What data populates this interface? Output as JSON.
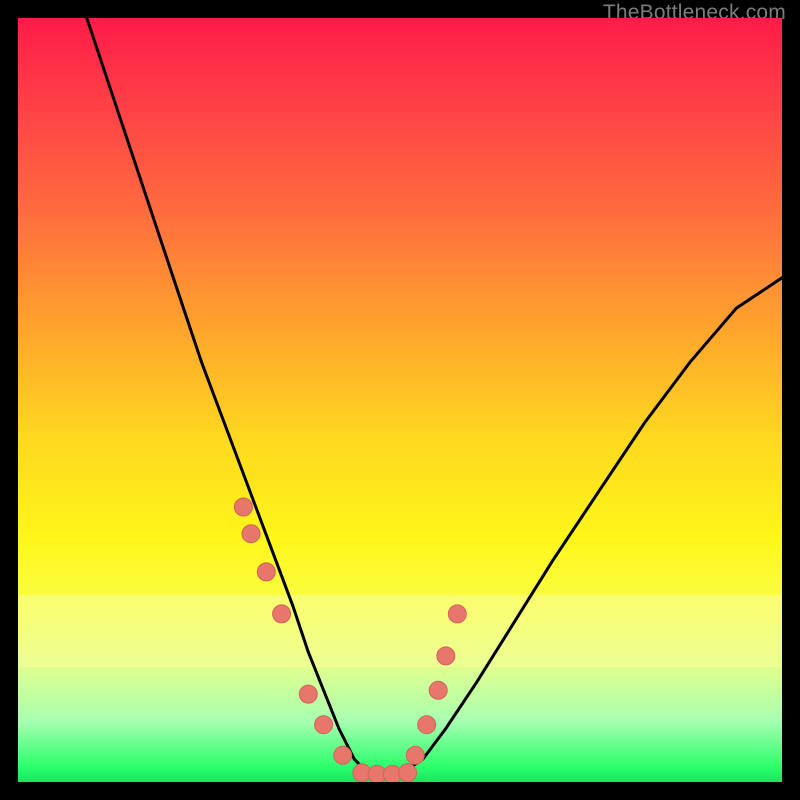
{
  "watermark": {
    "text": "TheBottleneck.com"
  },
  "colors": {
    "curve_stroke": "#000000",
    "dot_fill": "#e7766b",
    "dot_stroke": "#d1635a"
  },
  "chart_data": {
    "type": "line",
    "title": "",
    "xlabel": "",
    "ylabel": "",
    "xlim": [
      0,
      100
    ],
    "ylim": [
      0,
      100
    ],
    "grid": false,
    "notes": "Y is bottleneck % (0 at bottom, 100 at top). X is an unlabeled hardware balance axis. Curve is a V-shape; dots cluster near the minimum.",
    "series": [
      {
        "name": "bottleneck-curve",
        "kind": "line",
        "x": [
          9,
          12,
          15,
          18,
          21,
          24,
          27,
          30,
          33,
          36,
          38,
          40,
          42,
          44,
          46,
          48,
          50,
          53,
          56,
          60,
          65,
          70,
          76,
          82,
          88,
          94,
          100
        ],
        "y": [
          100,
          91,
          82,
          73,
          64,
          55,
          47,
          39,
          31,
          23,
          17,
          12,
          7,
          3,
          1,
          1,
          1,
          3,
          7,
          13,
          21,
          29,
          38,
          47,
          55,
          62,
          66
        ]
      },
      {
        "name": "sample-points",
        "kind": "scatter",
        "x": [
          29.5,
          30.5,
          32.5,
          34.5,
          38.0,
          40.0,
          42.5,
          45.0,
          47.0,
          49.0,
          51.0,
          52.0,
          53.5,
          55.0,
          56.0,
          57.5
        ],
        "y": [
          36.0,
          32.5,
          27.5,
          22.0,
          11.5,
          7.5,
          3.5,
          1.2,
          1.0,
          1.0,
          1.2,
          3.5,
          7.5,
          12.0,
          16.5,
          22.0
        ]
      }
    ]
  }
}
